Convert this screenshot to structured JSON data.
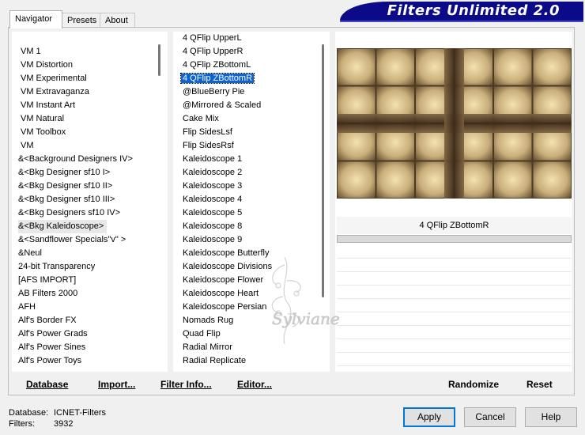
{
  "tabs": [
    "Navigator",
    "Presets",
    "About"
  ],
  "title": "Filters Unlimited 2.0",
  "categories": [
    "VM 1",
    "VM Distortion",
    "VM Experimental",
    "VM Extravaganza",
    "VM Instant Art",
    "VM Natural",
    "VM Toolbox",
    "VM",
    "&<Background Designers IV>",
    "&<Bkg Designer sf10 I>",
    "&<Bkg Designer sf10 II>",
    "&<Bkg Designer sf10 III>",
    "&<Bkg Designers sf10 IV>",
    "&<Bkg Kaleidoscope>",
    "&<Sandflower Specials\"v\" >",
    "&Neul",
    "24-bit Transparency",
    "[AFS IMPORT]",
    "AB Filters 2000",
    "AFH",
    "Alf's Border FX",
    "Alf's Power Grads",
    "Alf's Power Sines",
    "Alf's Power Toys"
  ],
  "filters": [
    "4 QFlip UpperL",
    "4 QFlip UpperR",
    "4 QFlip ZBottomL",
    "4 QFlip ZBottomR",
    "@BlueBerry Pie",
    "@Mirrored & Scaled",
    "Cake Mix",
    "Flip SidesLsf",
    "Flip SidesRsf",
    "Kaleidoscope 1",
    "Kaleidoscope 2",
    "Kaleidoscope 3",
    "Kaleidoscope 4",
    "Kaleidoscope 5",
    "Kaleidoscope 8",
    "Kaleidoscope 9",
    "Kaleidoscope Butterfly",
    "Kaleidoscope Divisions",
    "Kaleidoscope Flower",
    "Kaleidoscope Heart",
    "Kaleidoscope Persian",
    "Nomads Rug",
    "Quad Flip",
    "Radial Mirror",
    "Radial Replicate"
  ],
  "selected_category_index": 13,
  "selected_filter_index": 3,
  "preview": {
    "caption": "4 QFlip ZBottomR"
  },
  "buttons": {
    "database": "Database",
    "import": "Import...",
    "filter_info": "Filter Info...",
    "editor": "Editor...",
    "randomize": "Randomize",
    "reset": "Reset",
    "apply": "Apply",
    "cancel": "Cancel",
    "help": "Help"
  },
  "status": {
    "database_label": "Database:",
    "database_value": "ICNET-Filters",
    "filters_label": "Filters:",
    "filters_value": "3932"
  },
  "watermark_text": "Sylviane",
  "colors": {
    "banner": "#0b0b8a",
    "selection": "#0a64d8"
  }
}
